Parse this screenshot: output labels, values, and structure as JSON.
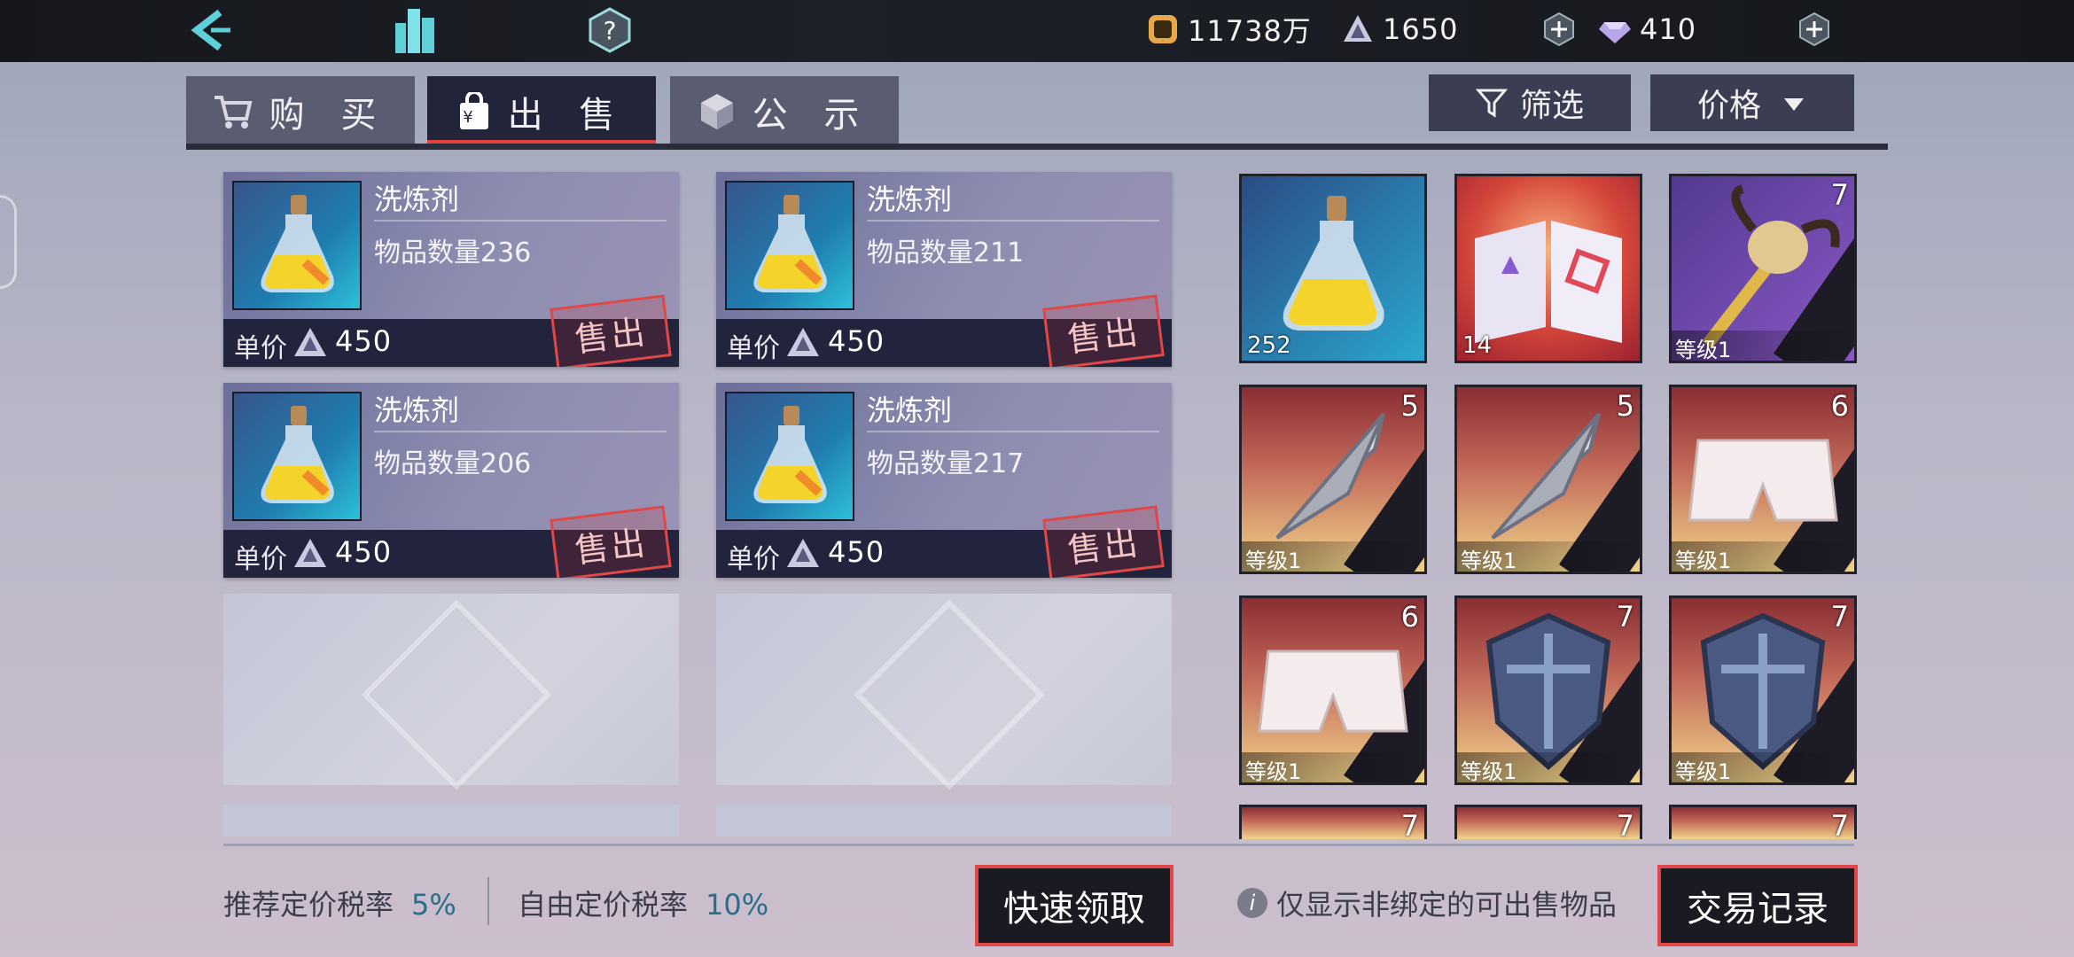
{
  "topbar": {
    "gold": "11738万",
    "crystal": "1650",
    "diamond": "410"
  },
  "tabs": {
    "buy": "购 买",
    "sell": "出 售",
    "notice": "公 示"
  },
  "filter": {
    "filter_label": "筛选",
    "price_label": "价格"
  },
  "listings": [
    {
      "name": "洗炼剂",
      "qty": "物品数量236",
      "price_label": "单价",
      "price": "450",
      "sold_label": "售出"
    },
    {
      "name": "洗炼剂",
      "qty": "物品数量211",
      "price_label": "单价",
      "price": "450",
      "sold_label": "售出"
    },
    {
      "name": "洗炼剂",
      "qty": "物品数量206",
      "price_label": "单价",
      "price": "450",
      "sold_label": "售出"
    },
    {
      "name": "洗炼剂",
      "qty": "物品数量217",
      "price_label": "单价",
      "price": "450",
      "sold_label": "售出"
    }
  ],
  "inventory": [
    {
      "type": "potion",
      "count": "252"
    },
    {
      "type": "book",
      "count": "14"
    },
    {
      "type": "staff",
      "star": "7",
      "level": "等级1"
    },
    {
      "type": "blade",
      "star": "5",
      "level": "等级1"
    },
    {
      "type": "blade",
      "star": "5",
      "level": "等级1"
    },
    {
      "type": "shorts",
      "star": "6",
      "level": "等级1"
    },
    {
      "type": "shorts",
      "star": "6",
      "level": "等级1"
    },
    {
      "type": "shield",
      "star": "7",
      "level": "等级1"
    },
    {
      "type": "shield",
      "star": "7",
      "level": "等级1"
    },
    {
      "type": "partial",
      "star": "7"
    },
    {
      "type": "partial",
      "star": "7"
    },
    {
      "type": "partial",
      "star": "7"
    }
  ],
  "footer": {
    "recommend_tax_label": "推荐定价税率",
    "recommend_tax": "5%",
    "free_tax_label": "自由定价税率",
    "free_tax": "10%",
    "quick_collect": "快速领取",
    "note": "仅显示非绑定的可出售物品",
    "records": "交易记录"
  }
}
